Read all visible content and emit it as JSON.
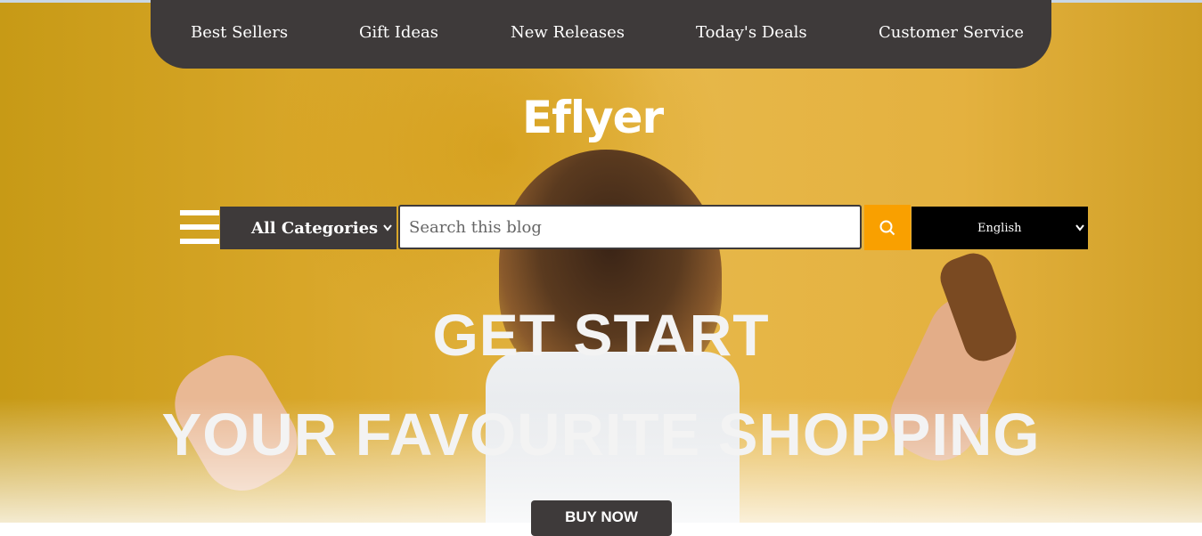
{
  "nav": {
    "items": [
      "Best Sellers",
      "Gift Ideas",
      "New Releases",
      "Today's Deals",
      "Customer Service"
    ]
  },
  "logo": "Eflyer",
  "search_bar": {
    "category_selected": "All Categories",
    "search_placeholder": "Search this blog",
    "language_selected": "English",
    "icons": {
      "menu": "hamburger-icon",
      "search": "search-icon",
      "dropdown": "chevron-down-icon"
    }
  },
  "hero": {
    "line1": "GET START",
    "line2": "YOUR FAVOURITE SHOPPING",
    "button": "BUY NOW"
  },
  "colors": {
    "nav_bg": "#3e3a3a",
    "accent": "#f9a000",
    "language_bg": "#000000",
    "hero_bg": "#dfae35"
  }
}
